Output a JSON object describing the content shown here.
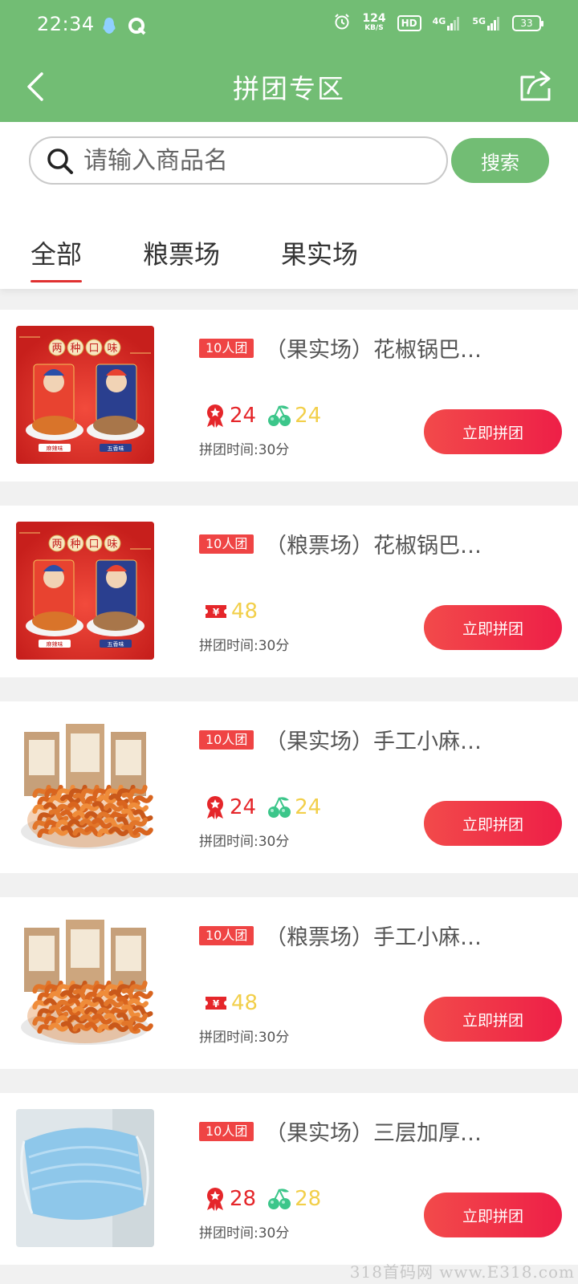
{
  "status_bar": {
    "time": "22:34",
    "net_speed_value": "124",
    "net_speed_unit": "KB/S",
    "hd_badge": "HD",
    "signal1": "4G",
    "signal2": "5G",
    "battery": "33"
  },
  "header": {
    "title": "拼团专区"
  },
  "search": {
    "placeholder": "请输入商品名",
    "button_label": "搜索"
  },
  "tabs": [
    {
      "label": "全部",
      "active": true
    },
    {
      "label": "粮票场",
      "active": false
    },
    {
      "label": "果实场",
      "active": false
    }
  ],
  "products": [
    {
      "tag": "10人团",
      "title": "（果实场）花椒锅巴…",
      "type": "fruit",
      "price_medal": "24",
      "price_cherry": "24",
      "duration": "拼团时间:30分",
      "button": "立即拼团",
      "image_icon": "guoba-snack-image",
      "image_text": [
        "两",
        "种",
        "口",
        "味"
      ],
      "image_sub": [
        "麻辣味",
        "五香味"
      ]
    },
    {
      "tag": "10人团",
      "title": "（粮票场）花椒锅巴…",
      "type": "ticket",
      "price_ticket": "48",
      "duration": "拼团时间:30分",
      "button": "立即拼团",
      "image_icon": "guoba-snack-image",
      "image_text": [
        "两",
        "种",
        "口",
        "味"
      ],
      "image_sub": [
        "麻辣味",
        "五香味"
      ]
    },
    {
      "tag": "10人团",
      "title": "（果实场）手工小麻…",
      "type": "fruit",
      "price_medal": "24",
      "price_cherry": "24",
      "duration": "拼团时间:30分",
      "button": "立即拼团",
      "image_icon": "mahua-snack-image"
    },
    {
      "tag": "10人团",
      "title": "（粮票场）手工小麻…",
      "type": "ticket",
      "price_ticket": "48",
      "duration": "拼团时间:30分",
      "button": "立即拼团",
      "image_icon": "mahua-snack-image"
    },
    {
      "tag": "10人团",
      "title": "（果实场）三层加厚…",
      "type": "fruit",
      "price_medal": "28",
      "price_cherry": "28",
      "duration": "拼团时间:30分",
      "button": "立即拼团",
      "image_icon": "face-mask-image"
    }
  ],
  "watermark": "318首码网 www.E318.com",
  "colors": {
    "header_green": "#72bd74",
    "accent_red": "#ef4444",
    "price_red": "#e5262a",
    "price_yellow": "#f2cf4a",
    "cherry_green": "#3cc68a"
  }
}
